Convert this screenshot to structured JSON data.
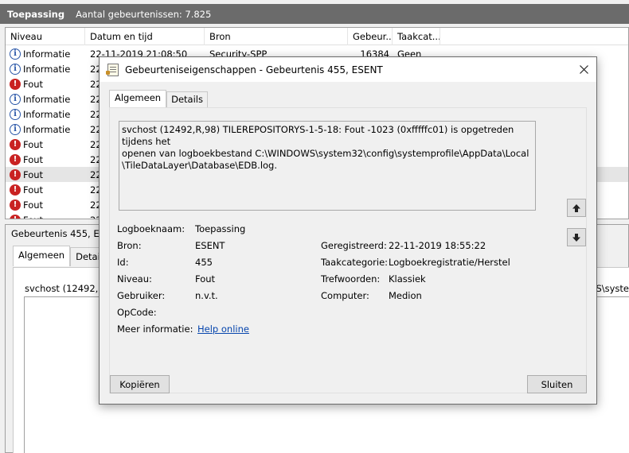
{
  "header": {
    "app_title": "Toepassing",
    "event_count": "Aantal gebeurtenissen: 7.825"
  },
  "list": {
    "columns": [
      "Niveau",
      "Datum en tijd",
      "Bron",
      "Gebeur...",
      "Taakcat..."
    ],
    "rows": [
      {
        "level": "Informatie",
        "type": "info",
        "datetime": "22-11-2019 21:08:50",
        "source": "Security-SPP",
        "id": "16384",
        "category": "Geen"
      },
      {
        "level": "Informatie",
        "type": "info",
        "datetime": "22"
      },
      {
        "level": "Fout",
        "type": "err",
        "datetime": "22"
      },
      {
        "level": "Informatie",
        "type": "info",
        "datetime": "22"
      },
      {
        "level": "Informatie",
        "type": "info",
        "datetime": "22"
      },
      {
        "level": "Informatie",
        "type": "info",
        "datetime": "22"
      },
      {
        "level": "Fout",
        "type": "err",
        "datetime": "22"
      },
      {
        "level": "Fout",
        "type": "err",
        "datetime": "22"
      },
      {
        "level": "Fout",
        "type": "err",
        "datetime": "22",
        "selected": true
      },
      {
        "level": "Fout",
        "type": "err",
        "datetime": "22"
      },
      {
        "level": "Fout",
        "type": "err",
        "datetime": "22"
      },
      {
        "level": "Fout",
        "type": "err",
        "datetime": "22"
      }
    ]
  },
  "detail": {
    "title": "Gebeurtenis 455, ESENT",
    "tabs": [
      "Algemeen",
      "Details"
    ],
    "text_left": "svchost (12492,R,9",
    "text_right": "/S\\syste"
  },
  "dialog": {
    "title": "Gebeurteniseigenschappen - Gebeurtenis 455, ESENT",
    "tabs": [
      "Algemeen",
      "Details"
    ],
    "message": "svchost (12492,R,98) TILEREPOSITORYS-1-5-18: Fout -1023 (0xfffffc01) is opgetreden tijdens het\nopenen van logboekbestand C:\\WINDOWS\\system32\\config\\systemprofile\\AppData\\Local\n\\TileDataLayer\\Database\\EDB.log.",
    "props": {
      "logname_label": "Logboeknaam:",
      "logname": "Toepassing",
      "source_label": "Bron:",
      "source": "ESENT",
      "id_label": "Id:",
      "id": "455",
      "level_label": "Niveau:",
      "level": "Fout",
      "user_label": "Gebruiker:",
      "user": "n.v.t.",
      "opcode_label": "OpCode:",
      "moreinfo_label": "Meer informatie:",
      "moreinfo_link": "Help online",
      "registered_label": "Geregistreerd:",
      "registered": "22-11-2019 18:55:22",
      "taskcat_label": "Taakcategorie:",
      "taskcat": "Logboekregistratie/Herstel",
      "keywords_label": "Trefwoorden:",
      "keywords": "Klassiek",
      "computer_label": "Computer:",
      "computer": "Medion"
    },
    "copy_label": "Kopiëren",
    "close_label": "Sluiten"
  }
}
